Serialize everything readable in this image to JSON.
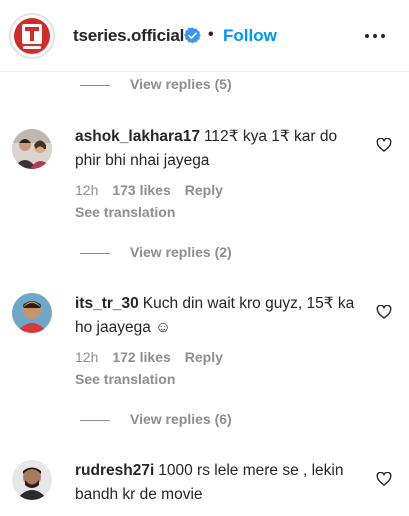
{
  "header": {
    "username": "tseries.official",
    "dot": "•",
    "follow_label": "Follow",
    "icons": {
      "verified": "verified-badge-icon",
      "more": "more-options-icon"
    },
    "colors": {
      "follow": "#0095f6",
      "verified": "#3897f0",
      "brand": "#d32a2a"
    }
  },
  "replies_top": {
    "label": "View replies (5)"
  },
  "comments": [
    {
      "username": "ashok_lakhara17",
      "text": "112₹ kya 1₹ kar do phir bhi nhai jayega",
      "time": "12h",
      "likes": "173 likes",
      "reply_label": "Reply",
      "translation_label": "See translation",
      "view_replies": "View replies (2)"
    },
    {
      "username": "its_tr_30",
      "text": "Kuch din wait kro guyz, 15₹ ka ho jaayega ☺",
      "time": "12h",
      "likes": "172 likes",
      "reply_label": "Reply",
      "translation_label": "See translation",
      "view_replies": "View replies (6)"
    },
    {
      "username": "rudresh27i",
      "text": "1000 rs lele mere se , lekin bandh kr de movie"
    }
  ]
}
